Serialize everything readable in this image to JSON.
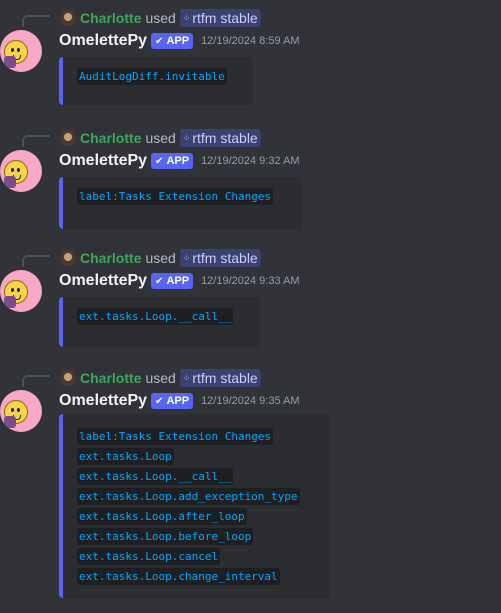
{
  "messages": [
    {
      "reply_user": "Charlotte",
      "reply_used": "used",
      "reply_command": "rtfm stable",
      "author": "OmelettePy",
      "badge": "APP",
      "timestamp": "12/19/2024 8:59 AM",
      "lines": [
        "AuditLogDiff.invitable"
      ]
    },
    {
      "reply_user": "Charlotte",
      "reply_used": "used",
      "reply_command": "rtfm stable",
      "author": "OmelettePy",
      "badge": "APP",
      "timestamp": "12/19/2024 9:32 AM",
      "lines": [
        "label:Tasks Extension Changes"
      ]
    },
    {
      "reply_user": "Charlotte",
      "reply_used": "used",
      "reply_command": "rtfm stable",
      "author": "OmelettePy",
      "badge": "APP",
      "timestamp": "12/19/2024 9:33 AM",
      "lines": [
        "ext.tasks.Loop.__call__"
      ]
    },
    {
      "reply_user": "Charlotte",
      "reply_used": "used",
      "reply_command": "rtfm stable",
      "author": "OmelettePy",
      "badge": "APP",
      "timestamp": "12/19/2024 9:35 AM",
      "lines": [
        "label:Tasks Extension Changes",
        "ext.tasks.Loop",
        "ext.tasks.Loop.__call__",
        "ext.tasks.Loop.add_exception_type",
        "ext.tasks.Loop.after_loop",
        "ext.tasks.Loop.before_loop",
        "ext.tasks.Loop.cancel",
        "ext.tasks.Loop.change_interval"
      ]
    }
  ],
  "icons": {
    "badge_check": "check-icon",
    "command": "slash-command-icon"
  },
  "colors": {
    "background": "#313338",
    "embed_background": "#2b2d31",
    "embed_border": "#5865f2",
    "link_code": "#00a8fc",
    "replier_name": "#3ba55c",
    "app_badge": "#5865f2"
  }
}
